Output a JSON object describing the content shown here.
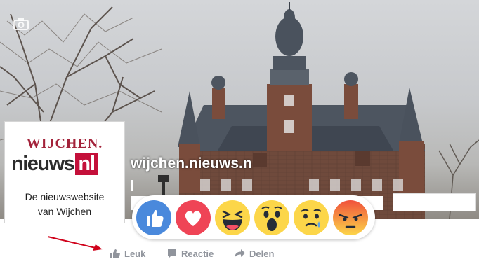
{
  "cover": {
    "camera_icon": "camera-icon"
  },
  "profile": {
    "logo_line1": "WIJCHEN.",
    "logo_line2_a": "nieuws",
    "logo_line2_b": "nl",
    "tagline_line1": "De nieuwswebsite",
    "tagline_line2": "van Wijchen"
  },
  "page": {
    "name": "wijchen.nieuws.n"
  },
  "reactions": [
    {
      "name": "like",
      "icon": "thumbs-up-icon",
      "color": "#4a89dc"
    },
    {
      "name": "love",
      "icon": "heart-icon",
      "color": "#ef4456"
    },
    {
      "name": "haha",
      "icon": "laughing-face-icon",
      "color": "#fcd649"
    },
    {
      "name": "wow",
      "icon": "surprised-face-icon",
      "color": "#fcd649"
    },
    {
      "name": "sad",
      "icon": "crying-face-icon",
      "color": "#fcd649"
    },
    {
      "name": "angry",
      "icon": "angry-face-icon",
      "color": "#f16b2c"
    }
  ],
  "actions": {
    "like_label": "Leuk",
    "comment_label": "Reactie",
    "share_label": "Delen"
  },
  "colors": {
    "action_text": "#90949c",
    "arrow": "#d0021b",
    "logo_red": "#c4103a"
  }
}
